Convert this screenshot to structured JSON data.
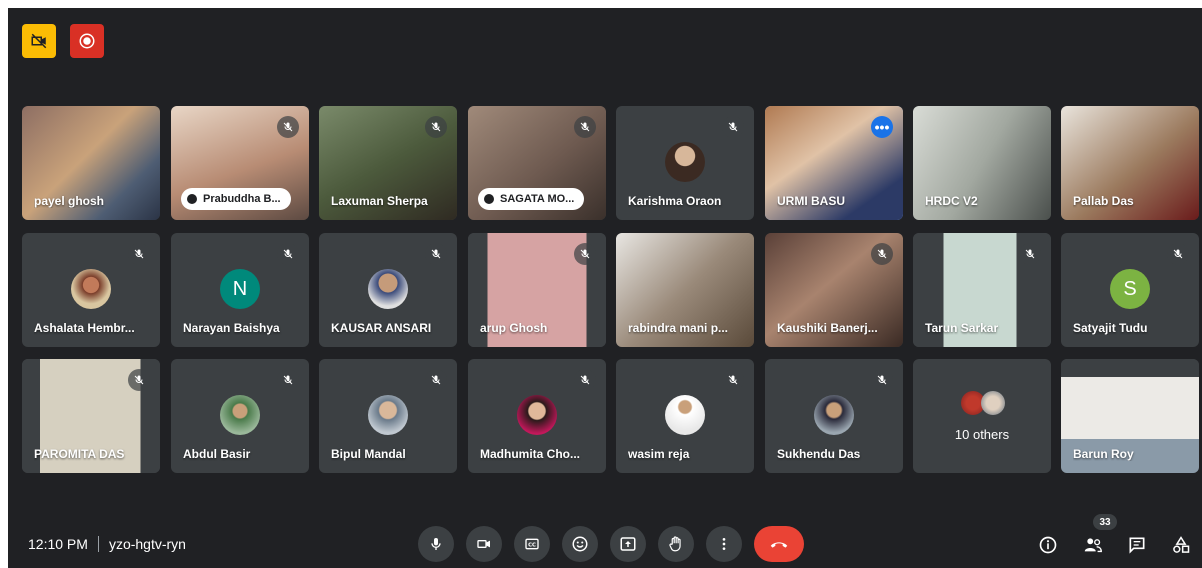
{
  "meeting": {
    "time": "12:10 PM",
    "code": "yzo-hgtv-ryn",
    "participant_count": "33"
  },
  "colors": {
    "background": "#202124",
    "tile": "#3c4043",
    "active_border": "#8ab4f8",
    "end_call": "#ea4335",
    "top_badge_yellow": "#fbbc04",
    "top_badge_red": "#d93025",
    "avatar_n": "#00897b",
    "avatar_s": "#7cb342"
  },
  "top_badges": [
    {
      "icon": "no-camera-icon"
    },
    {
      "icon": "record-icon"
    }
  ],
  "rows": [
    [
      {
        "name": "payel ghosh",
        "type": "video",
        "muted": false
      },
      {
        "name": "Prabuddha B...",
        "type": "video",
        "muted": true,
        "pill": true
      },
      {
        "name": "Laxuman Sherpa",
        "type": "video",
        "muted": true
      },
      {
        "name": "SAGATA MO...",
        "type": "video",
        "muted": true,
        "pill": true
      },
      {
        "name": "Karishma Oraon",
        "type": "photo",
        "muted": true
      },
      {
        "name": "URMI BASU",
        "type": "video",
        "muted": false,
        "active": true
      },
      {
        "name": "HRDC V2",
        "type": "video",
        "muted": false
      },
      {
        "name": "Pallab Das",
        "type": "video",
        "muted": false
      }
    ],
    [
      {
        "name": "Ashalata Hembr...",
        "type": "photo",
        "muted": true
      },
      {
        "name": "Narayan Baishya",
        "type": "letter",
        "letter": "N",
        "muted": true
      },
      {
        "name": "KAUSAR ANSARI",
        "type": "photo",
        "muted": true
      },
      {
        "name": "arup Ghosh",
        "type": "video",
        "muted": true
      },
      {
        "name": "rabindra mani p...",
        "type": "video",
        "muted": false
      },
      {
        "name": "Kaushiki Banerj...",
        "type": "video",
        "muted": true
      },
      {
        "name": "Tarun Sarkar",
        "type": "video",
        "muted": true
      },
      {
        "name": "Satyajit Tudu",
        "type": "letter",
        "letter": "S",
        "muted": true
      }
    ],
    [
      {
        "name": "PAROMITA DAS",
        "type": "video",
        "muted": true
      },
      {
        "name": "Abdul Basir",
        "type": "photo",
        "muted": true
      },
      {
        "name": "Bipul Mandal",
        "type": "photo",
        "muted": true
      },
      {
        "name": "Madhumita Cho...",
        "type": "photo",
        "muted": true
      },
      {
        "name": "wasim reja",
        "type": "photo",
        "muted": true
      },
      {
        "name": "Sukhendu Das",
        "type": "photo",
        "muted": true
      },
      {
        "name": "10 others",
        "type": "others",
        "muted": false
      },
      {
        "name": "Barun Roy",
        "type": "video",
        "muted": false
      }
    ]
  ],
  "controls": [
    {
      "icon": "microphone-icon"
    },
    {
      "icon": "camera-icon"
    },
    {
      "icon": "captions-icon"
    },
    {
      "icon": "emoji-icon"
    },
    {
      "icon": "present-icon"
    },
    {
      "icon": "raise-hand-icon"
    },
    {
      "icon": "more-options-icon"
    },
    {
      "icon": "end-call-icon"
    }
  ],
  "right_controls": [
    {
      "icon": "info-icon"
    },
    {
      "icon": "people-icon"
    },
    {
      "icon": "chat-icon"
    },
    {
      "icon": "activities-icon"
    }
  ]
}
